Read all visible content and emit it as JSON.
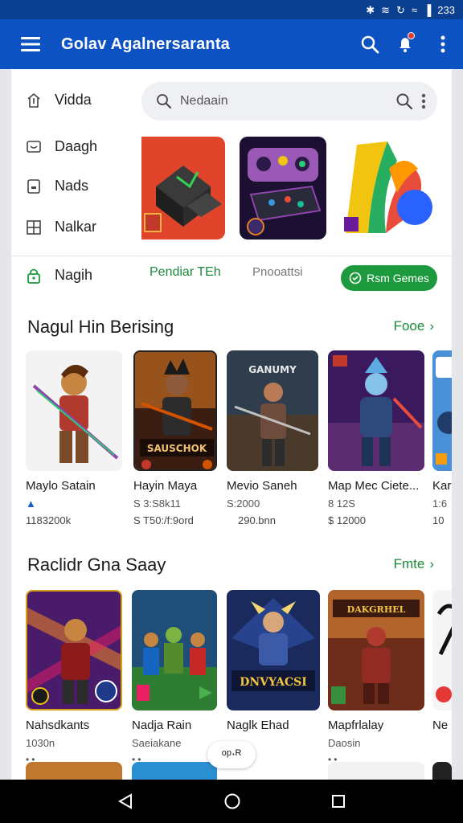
{
  "status": {
    "time": "233"
  },
  "app_bar": {
    "title": "Golav Agalnersaranta"
  },
  "nav": {
    "items": [
      {
        "label": "Vidda",
        "icon": "upload-icon"
      },
      {
        "label": "Daagh",
        "icon": "chat-icon"
      },
      {
        "label": "Nads",
        "icon": "device-icon"
      },
      {
        "label": "Nalkar",
        "icon": "grid-icon"
      },
      {
        "label": "Nagih",
        "icon": "lock-icon"
      }
    ]
  },
  "search": {
    "placeholder": "Nedaain"
  },
  "tabs": {
    "active": "Pendiar TEh",
    "inactive": "Pnooattsi",
    "button": "Rsm Gemes"
  },
  "section1": {
    "title": "Nagul Hin Berising",
    "more": "Fooe",
    "cards": [
      {
        "name": "Maylo Satain",
        "meta": "▲",
        "meta2": "1183200k"
      },
      {
        "name": "Hayin Maya",
        "meta": "S 3:S8k11",
        "meta2": "S T50:/f:9ord"
      },
      {
        "name": "Mevio Saneh",
        "meta": "S:2000",
        "meta2": "290.bnn"
      },
      {
        "name": "Map Mec Ciete...",
        "meta": "8 12S",
        "meta2": "$ 12000"
      },
      {
        "name": "Kar",
        "meta": "1:6",
        "meta2": "10"
      }
    ]
  },
  "section2": {
    "title": "Raclidr Gna Saay",
    "more": "Fmte",
    "cards": [
      {
        "name": "Nahsdkants",
        "meta": "1030n"
      },
      {
        "name": "Nadja Rain",
        "meta": "Saeiakane"
      },
      {
        "name": "Naglk Ehad",
        "meta": ""
      },
      {
        "name": "Mapfrlalay",
        "meta": "Daosin"
      },
      {
        "name": "Ne",
        "meta": ""
      }
    ]
  },
  "cover_titles": {
    "c2": "SAUSCHOK",
    "c3": "GANUMY",
    "c8": "DNVYACSI",
    "c9": "DAKGRHEL"
  },
  "float_chip": {
    "label": "ᵒᵖ⋅ᴿ"
  }
}
